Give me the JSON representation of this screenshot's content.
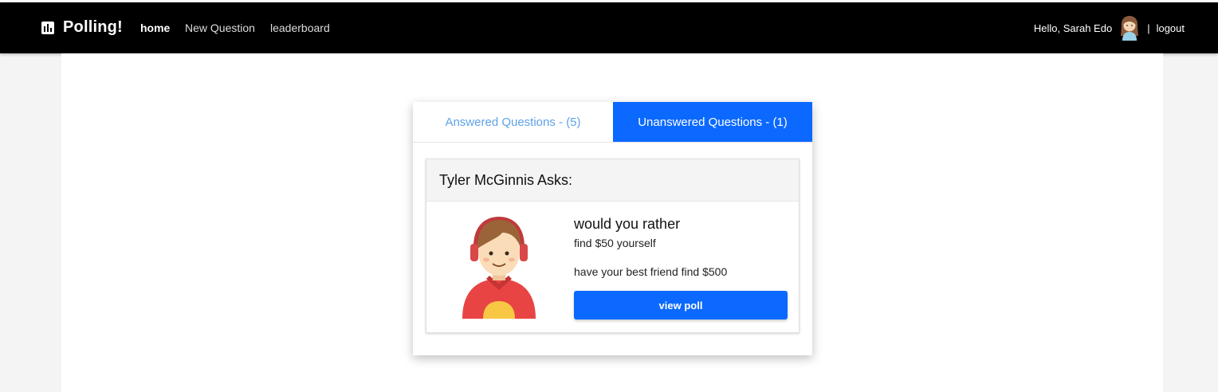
{
  "nav": {
    "brand": "Polling!",
    "links": [
      {
        "label": "home",
        "active": true
      },
      {
        "label": "New Question",
        "active": false
      },
      {
        "label": "leaderboard",
        "active": false
      }
    ],
    "greeting": "Hello, Sarah Edo",
    "separator": "|",
    "logout": "logout",
    "brand_icon": "bar-chart-icon"
  },
  "tabs": {
    "answered": "Answered Questions - (5)",
    "unanswered": "Unanswered Questions - (1)",
    "active": "unanswered"
  },
  "question": {
    "asker": "Tyler McGinnis Asks:",
    "title": "would you rather",
    "option_one": "find $50 yourself",
    "option_two": "have your best friend find $500",
    "button": "view poll"
  },
  "colors": {
    "primary": "#0b69ff",
    "navbar": "#000000",
    "inactive_tab_text": "#5ea2e8"
  }
}
